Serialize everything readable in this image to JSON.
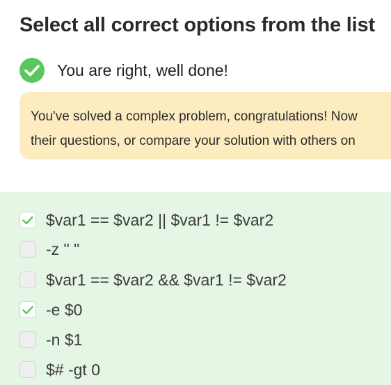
{
  "title": "Select all correct options from the list",
  "result": {
    "icon": "check-circle-icon",
    "message": "You are right, well done!",
    "color": "#59c75e"
  },
  "feedback": {
    "line1": "You've solved a complex problem, congratulations! Now",
    "line2": "their questions, or compare your solution with others on",
    "background": "#fdecc0"
  },
  "options_panel_color": "#e6f6e4",
  "options": [
    {
      "label": "$var1 == $var2 || $var1 != $var2",
      "checked": true
    },
    {
      "label": "-z \" \"",
      "checked": false
    },
    {
      "label": "$var1 == $var2 && $var1 != $var2",
      "checked": false
    },
    {
      "label": "-e $0",
      "checked": true
    },
    {
      "label": "-n $1",
      "checked": false
    },
    {
      "label": "$# -gt 0",
      "checked": false
    }
  ]
}
